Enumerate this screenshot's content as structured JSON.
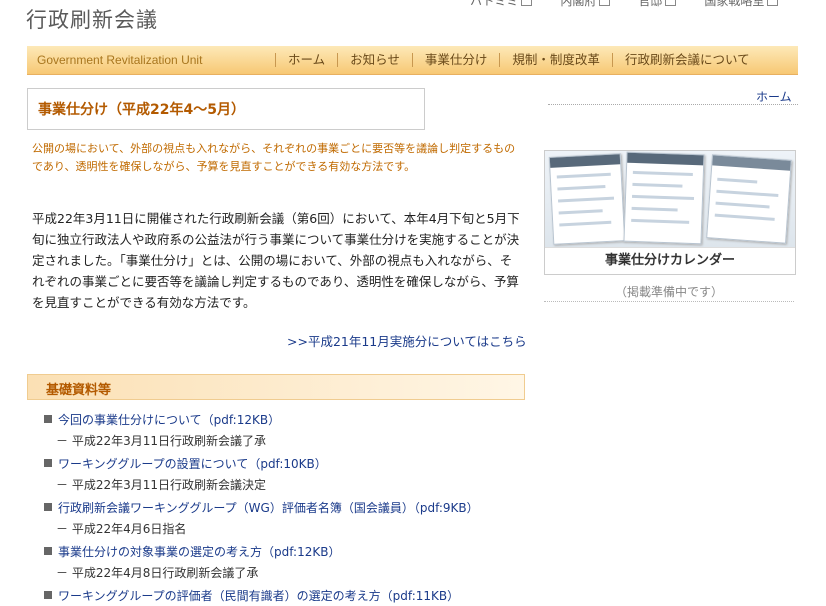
{
  "site_title": "行政刷新会議",
  "top_links": [
    "ハトミミ",
    "内閣府",
    "官邸",
    "国家戦略室"
  ],
  "nav": {
    "unit_name": "Government Revitalization Unit",
    "items": [
      "ホーム",
      "お知らせ",
      "事業仕分け",
      "規制・制度改革",
      "行政刷新会議について"
    ]
  },
  "page_heading": "事業仕分け（平成22年4〜5月）",
  "home_link": "ホーム",
  "intro": "公開の場において、外部の視点も入れながら、それぞれの事業ごとに要否等を議論し判定するものであり、透明性を確保しながら、予算を見直すことができる有効な方法です。",
  "body": "平成22年3月11日に開催された行政刷新会議（第6回）において、本年4月下旬と5月下旬に独立行政法人や政府系の公益法が行う事業について事業仕分けを実施することが決定されました。「事業仕分け」とは、公開の場において、外部の視点も入れながら、それぞれの事業ごとに要否等を議論し判定するものであり、透明性を確保しながら、予算を見直すことができる有効な方法です。",
  "prev_link": ">>平成21年11月実施分についてはこちら",
  "calendar": {
    "caption": "事業仕分けカレンダー",
    "note": "（掲載準備中です）"
  },
  "section_title": "基礎資料等",
  "documents": [
    {
      "title": "今回の事業仕分けについて（pdf:12KB）",
      "sub": "－ 平成22年3月11日行政刷新会議了承"
    },
    {
      "title": "ワーキンググループの設置について（pdf:10KB）",
      "sub": "－ 平成22年3月11日行政刷新会議決定"
    },
    {
      "title": "行政刷新会議ワーキンググループ（WG）評価者名簿（国会議員）（pdf:9KB）",
      "sub": "－ 平成22年4月6日指名"
    },
    {
      "title": "事業仕分けの対象事業の選定の考え方（pdf:12KB）",
      "sub": "－ 平成22年4月8日行政刷新会議了承"
    },
    {
      "title": "ワーキンググループの評価者（民間有識者）の選定の考え方（pdf:11KB）",
      "sub": ""
    }
  ]
}
